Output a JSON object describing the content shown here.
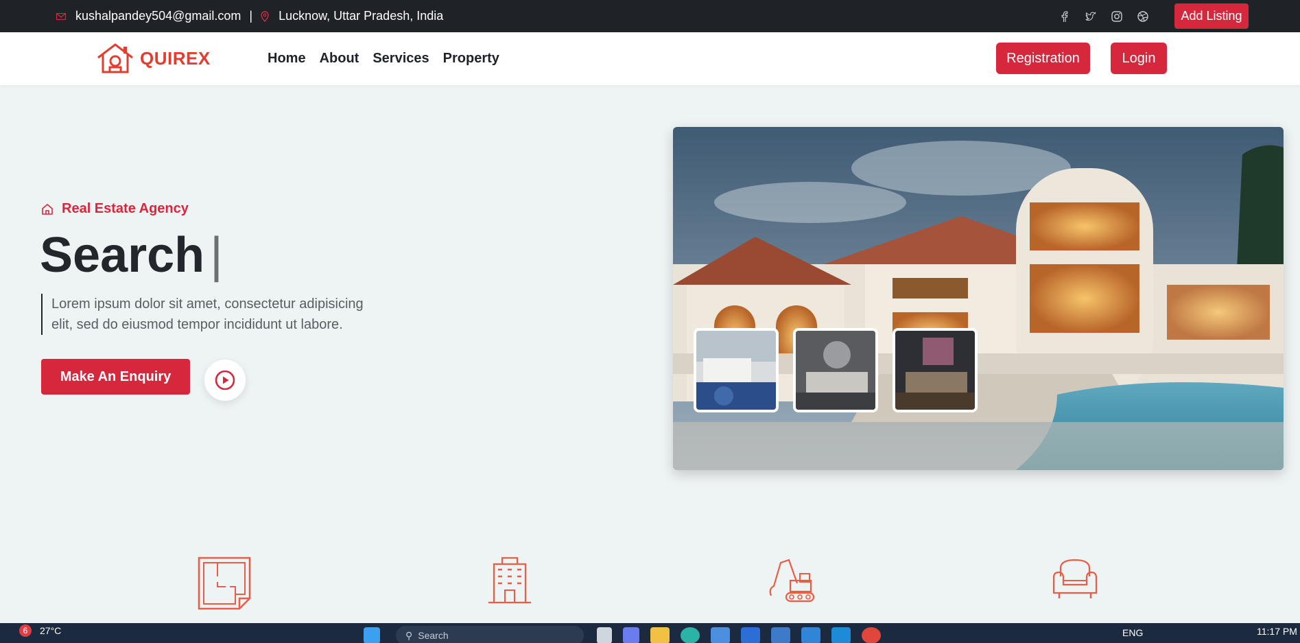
{
  "topbar": {
    "email": "kushalpandey504@gmail.com",
    "separator": "|",
    "location": "Lucknow, Uttar Pradesh, India",
    "social_icons": [
      "facebook-icon",
      "twitter-icon",
      "instagram-icon",
      "dribbble-icon"
    ],
    "add_listing_label": "Add Listing"
  },
  "nav": {
    "brand": "QUIREX",
    "links": [
      "Home",
      "About",
      "Services",
      "Property"
    ],
    "registration_label": "Registration",
    "login_label": "Login"
  },
  "hero": {
    "eyebrow": "Real Estate Agency",
    "title": "Search",
    "cursor": "|",
    "description": "Lorem ipsum dolor sit amet, consectetur adipisicing elit, sed do eiusmod tempor incididunt ut labore.",
    "enquiry_label": "Make An Enquiry"
  },
  "features": [
    "floor-plan-icon",
    "apartment-building-icon",
    "excavator-icon",
    "armchair-icon"
  ],
  "taskbar": {
    "notification_count": "6",
    "temperature": "27°C",
    "search_placeholder": "Search",
    "language": "ENG",
    "time": "11:17 PM"
  },
  "colors": {
    "accent": "#d7273d",
    "brand": "#e23d2f",
    "topbar_bg": "#1f2328",
    "page_bg": "#eef3f3"
  }
}
